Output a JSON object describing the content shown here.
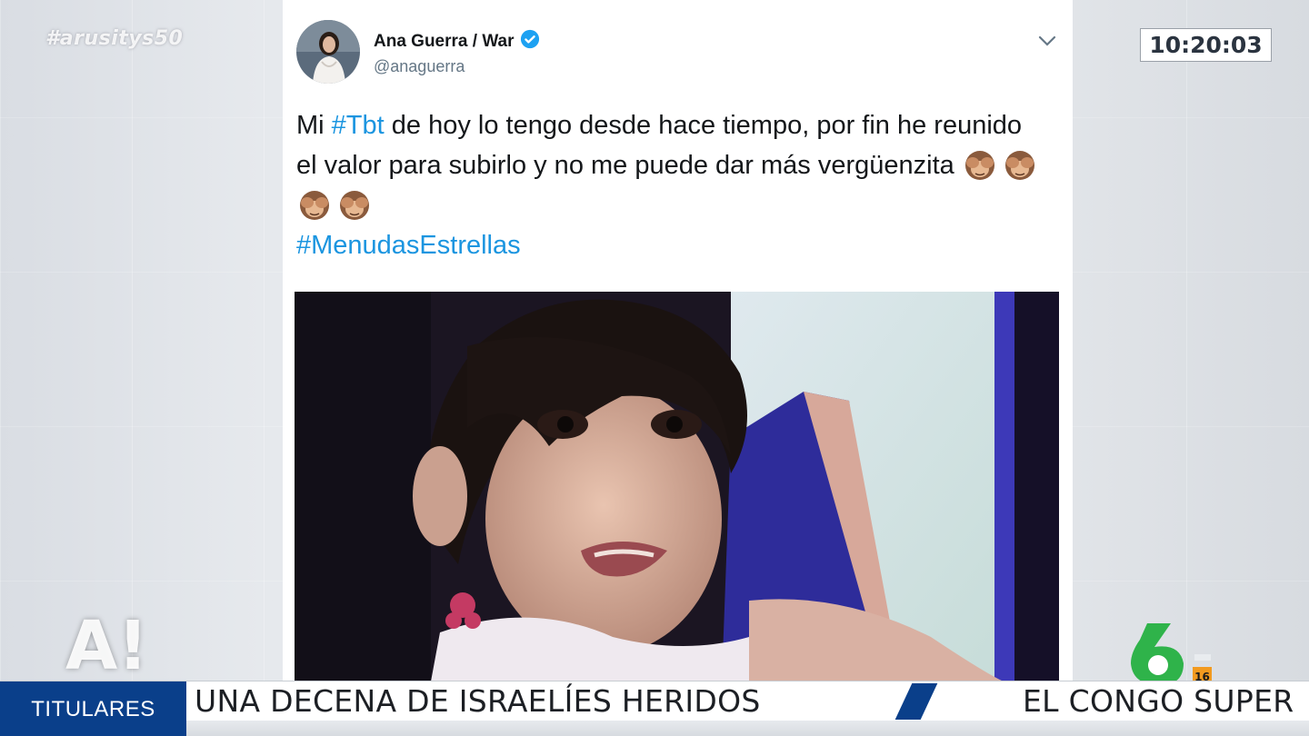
{
  "overlay": {
    "hashtag": "#arusitys50",
    "clock": "10:20:03",
    "channel_logo": "A!"
  },
  "tweet": {
    "display_name": "Ana Guerra / War",
    "handle": "@anaguerra",
    "text": {
      "p1": "Mi ",
      "tag1": "#Tbt",
      "p2": " de hoy lo tengo desde hace tiempo, por fin he reunido el valor para subirlo y no me puede dar más vergüenzita",
      "tag2": "#MenudasEstrellas"
    },
    "emoji_icon": "see-no-evil-monkey",
    "emoji_count": 4
  },
  "ticker": {
    "label": "TITULARES",
    "headline": "UNA DECENA DE ISRAELÍES HERIDOS",
    "next_headline": "EL CONGO SUPER",
    "network_badge": "16"
  },
  "colors": {
    "ticker_blue": "#0a3f8a",
    "link_blue": "#1b95e0",
    "logo_green": "#2fb34a",
    "badge_orange": "#f29a1f"
  }
}
